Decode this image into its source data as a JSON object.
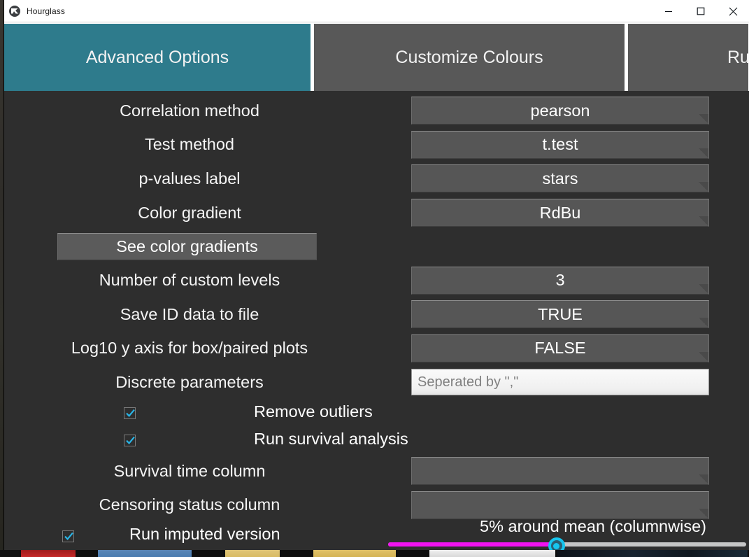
{
  "window": {
    "title": "Hourglass",
    "app_icon": "hourglass-app-icon",
    "controls": {
      "minimize": "minimize-icon",
      "maximize": "maximize-icon",
      "close": "close-icon"
    }
  },
  "tabs": [
    {
      "label": "Advanced Options",
      "active": true
    },
    {
      "label": "Customize Colours",
      "active": false
    },
    {
      "label": "Ru",
      "active": false
    }
  ],
  "form": {
    "rows": [
      {
        "label": "Correlation method",
        "value": "pearson",
        "control": "select"
      },
      {
        "label": "Test method",
        "value": "t.test",
        "control": "select"
      },
      {
        "label": "p-values label",
        "value": "stars",
        "control": "select"
      },
      {
        "label": "Color gradient",
        "value": "RdBu",
        "control": "select"
      },
      {
        "label": "Number of custom levels",
        "value": "3",
        "control": "select"
      },
      {
        "label": "Save ID data to file",
        "value": "TRUE",
        "control": "select"
      },
      {
        "label": "Log10 y axis for box/paired plots",
        "value": "FALSE",
        "control": "select"
      },
      {
        "label": "Discrete parameters",
        "value": "",
        "placeholder": "Seperated by \",\"",
        "control": "textinput"
      },
      {
        "label": "Survival time column",
        "value": "",
        "control": "select"
      },
      {
        "label": "Censoring status column",
        "value": "",
        "control": "select"
      }
    ],
    "see_gradients_button": "See color gradients",
    "checkboxes": [
      {
        "label": "Remove outliers",
        "checked": true
      },
      {
        "label": "Run survival analysis",
        "checked": true
      },
      {
        "label": "Run imputed version",
        "checked": true
      }
    ],
    "slider": {
      "caption": "5% around mean (columnwise)",
      "percent": 47
    }
  },
  "colors": {
    "active_tab": "#2e7b8c",
    "inactive_tab": "#585858",
    "panel_bg": "#2e2e2e",
    "slider_fill": "#f013f0",
    "slider_handle": "#16c6ef",
    "checkmark": "#29b6e8"
  }
}
